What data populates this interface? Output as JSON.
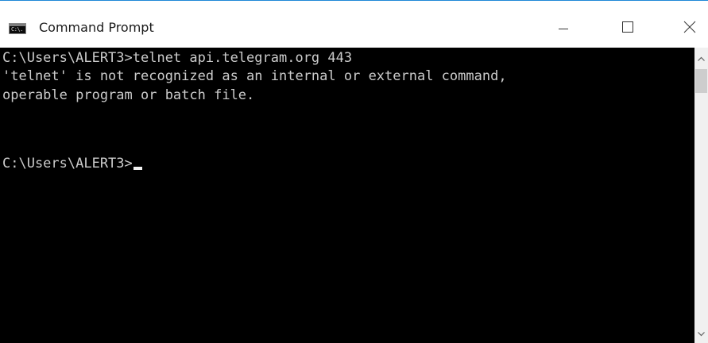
{
  "window": {
    "title": "Command Prompt",
    "app_icon": "console-icon",
    "app_icon_glyph": "C:\\.",
    "controls": {
      "minimize_icon": "minimize-icon",
      "maximize_icon": "maximize-icon",
      "close_icon": "close-icon"
    }
  },
  "console": {
    "lines": [
      "C:\\Users\\ALERT3>telnet api.telegram.org 443",
      "'telnet' is not recognized as an internal or external command,",
      "operable program or batch file."
    ],
    "prompt": "C:\\Users\\ALERT3>",
    "background": "#000000",
    "foreground": "#CCCCCC"
  },
  "scrollbar": {
    "up_icon": "scroll-up-icon",
    "down_icon": "scroll-down-icon"
  },
  "colors": {
    "window_border": "#1E87D7",
    "titlebar": "#FFFFFF"
  }
}
